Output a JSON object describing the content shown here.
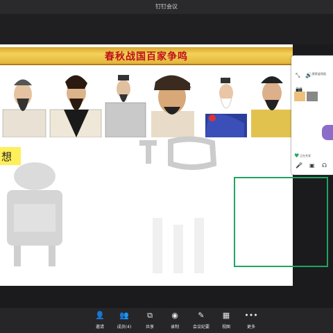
{
  "window": {
    "title": "钉钉会议"
  },
  "slide": {
    "banner_title": "春秋战国百家争鸣",
    "highlight_text": "想"
  },
  "gallery": {
    "tile_name": "默默爱简图",
    "tile_sub": "正在共享",
    "controls": [
      "麦克风",
      "视频",
      "语音"
    ]
  },
  "toolbar": {
    "items": [
      {
        "label": "邀请",
        "icon": "add-user-icon"
      },
      {
        "label": "成员(4)",
        "icon": "members-icon"
      },
      {
        "label": "共享",
        "icon": "share-screen-icon"
      },
      {
        "label": "录制",
        "icon": "record-icon"
      },
      {
        "label": "会议纪要",
        "icon": "notes-icon"
      },
      {
        "label": "视图",
        "icon": "grid-view-icon"
      },
      {
        "label": "更多",
        "icon": "more-icon"
      }
    ]
  },
  "colors": {
    "accent_green": "#1fa463",
    "banner_red": "#c0101a",
    "banner_gold": "#f2d25a"
  }
}
